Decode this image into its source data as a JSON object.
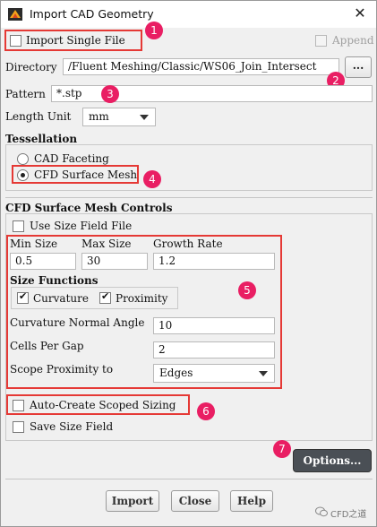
{
  "window": {
    "title": "Import CAD Geometry",
    "close_symbol": "✕"
  },
  "import_single_file": {
    "label": "Import Single File",
    "checked": false
  },
  "append": {
    "label": "Append",
    "checked": false,
    "enabled": false
  },
  "directory": {
    "label": "Directory",
    "value": "/Fluent Meshing/Classic/WS06_Join_Intersect",
    "browse_label": "..."
  },
  "pattern": {
    "label": "Pattern",
    "value": "*.stp"
  },
  "length_unit": {
    "label": "Length Unit",
    "value": "mm"
  },
  "tessellation": {
    "heading": "Tessellation",
    "options": [
      {
        "label": "CAD Faceting",
        "selected": false
      },
      {
        "label": "CFD Surface Mesh",
        "selected": true
      }
    ]
  },
  "cfd_controls": {
    "heading": "CFD Surface Mesh Controls",
    "use_size_field_file": {
      "label": "Use Size Field File",
      "checked": false
    },
    "min_size": {
      "label": "Min Size",
      "value": "0.5"
    },
    "max_size": {
      "label": "Max Size",
      "value": "30"
    },
    "growth_rate": {
      "label": "Growth Rate",
      "value": "1.2"
    },
    "size_functions": {
      "heading": "Size Functions",
      "curvature": {
        "label": "Curvature",
        "checked": true
      },
      "proximity": {
        "label": "Proximity",
        "checked": true
      }
    },
    "curvature_normal_angle": {
      "label": "Curvature Normal Angle",
      "value": "10"
    },
    "cells_per_gap": {
      "label": "Cells Per Gap",
      "value": "2"
    },
    "scope_proximity_to": {
      "label": "Scope Proximity to",
      "value": "Edges"
    },
    "auto_create_scoped_sizing": {
      "label": "Auto-Create Scoped Sizing",
      "checked": false
    },
    "save_size_field": {
      "label": "Save Size Field",
      "checked": false
    }
  },
  "options_button": "Options...",
  "buttons": {
    "import": "Import",
    "close": "Close",
    "help": "Help"
  },
  "badges": [
    "1",
    "2",
    "3",
    "4",
    "5",
    "6",
    "7"
  ],
  "watermark": "CFD之道",
  "colors": {
    "highlight": "#e53935",
    "badge": "#e91e63",
    "options_button": "#4a4f55"
  }
}
